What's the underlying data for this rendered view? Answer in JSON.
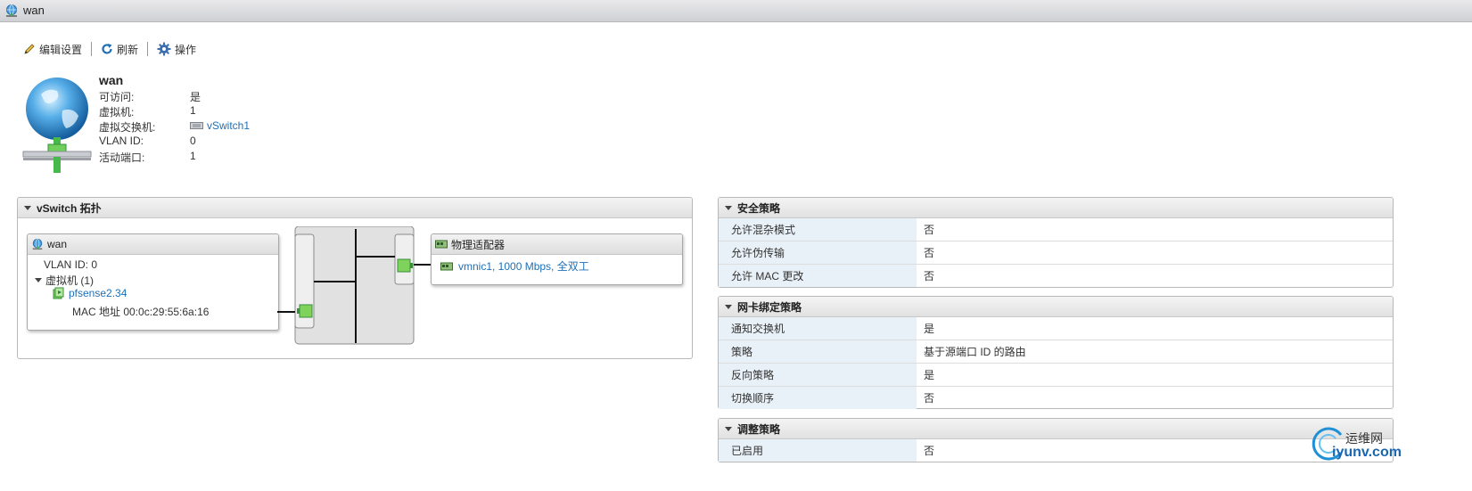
{
  "window": {
    "title": "wan"
  },
  "toolbar": {
    "edit_label": "编辑设置",
    "refresh_label": "刷新",
    "actions_label": "操作"
  },
  "summary": {
    "name": "wan",
    "rows": [
      {
        "key": "可访问:",
        "value": "是"
      },
      {
        "key": "虚拟机:",
        "value": "1"
      },
      {
        "key": "虚拟交换机:",
        "value": "vSwitch1"
      },
      {
        "key": "VLAN ID:",
        "value": "0"
      },
      {
        "key": "活动端口:",
        "value": "1"
      }
    ]
  },
  "topology": {
    "title": "vSwitch 拓扑",
    "portgroup": {
      "name": "wan",
      "vlan": "VLAN ID: 0",
      "vms_label": "虚拟机 (1)",
      "vm_name": "pfsense2.34",
      "mac": "MAC 地址 00:0c:29:55:6a:16"
    },
    "adapters": {
      "title": "物理适配器",
      "nic": "vmnic1, 1000 Mbps, 全双工"
    }
  },
  "security_policy": {
    "title": "安全策略",
    "rows": [
      {
        "key": "允许混杂模式",
        "value": "否"
      },
      {
        "key": "允许伪传输",
        "value": "否"
      },
      {
        "key": "允许 MAC 更改",
        "value": "否"
      }
    ]
  },
  "teaming_policy": {
    "title": "网卡绑定策略",
    "rows": [
      {
        "key": "通知交换机",
        "value": "是"
      },
      {
        "key": "策略",
        "value": "基于源端口 ID 的路由"
      },
      {
        "key": "反向策略",
        "value": "是"
      },
      {
        "key": "切换顺序",
        "value": "否"
      }
    ]
  },
  "shaping_policy": {
    "title": "调整策略",
    "rows": [
      {
        "key": "已启用",
        "value": "否"
      }
    ]
  },
  "watermark": {
    "cn": "运维网",
    "domain": "iyunv.com"
  },
  "colors": {
    "link": "#1f6fb6",
    "key_cell_bg": "#e9f1f8",
    "port_green": "#7fd35b"
  }
}
